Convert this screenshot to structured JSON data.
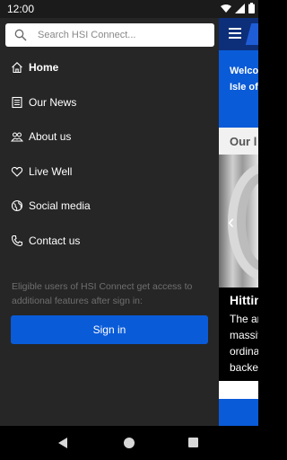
{
  "status_bar": {
    "time": "12:00"
  },
  "search": {
    "placeholder": "Search HSI Connect..."
  },
  "drawer": {
    "items": [
      {
        "label": "Home",
        "icon": "home-icon",
        "active": true
      },
      {
        "label": "Our News",
        "icon": "newspaper-icon",
        "active": false
      },
      {
        "label": "About us",
        "icon": "people-icon",
        "active": false
      },
      {
        "label": "Live Well",
        "icon": "heart-icon",
        "active": false
      },
      {
        "label": "Social media",
        "icon": "globe-icon",
        "active": false
      },
      {
        "label": "Contact us",
        "icon": "phone-icon",
        "active": false
      }
    ],
    "eligible_text": "Eligible users of HSI Connect get access to additional features after sign in:",
    "sign_in_label": "Sign in"
  },
  "background_app": {
    "welcome_line1": "Welco",
    "welcome_line2": "Isle of",
    "section_title": "Our l",
    "story_title": "Hittin",
    "story_lines": [
      "The ar",
      "massiv",
      "ordina",
      "backe"
    ]
  },
  "colors": {
    "drawer_bg": "#262626",
    "accent": "#0a5bd8",
    "header": "#0d2f7a",
    "muted_text": "#6f6f6f"
  }
}
